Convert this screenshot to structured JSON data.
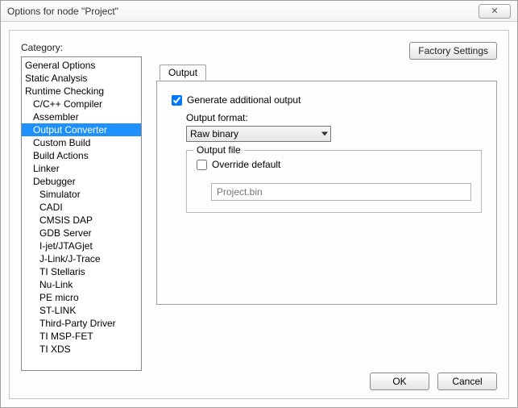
{
  "window": {
    "title": "Options for node \"Project\"",
    "close_label": "✕"
  },
  "category_label": "Category:",
  "categories": [
    {
      "label": "General Options",
      "indent": false
    },
    {
      "label": "Static Analysis",
      "indent": false
    },
    {
      "label": "Runtime Checking",
      "indent": false
    },
    {
      "label": "C/C++ Compiler",
      "indent": true
    },
    {
      "label": "Assembler",
      "indent": true
    },
    {
      "label": "Output Converter",
      "indent": true,
      "selected": true
    },
    {
      "label": "Custom Build",
      "indent": true
    },
    {
      "label": "Build Actions",
      "indent": true
    },
    {
      "label": "Linker",
      "indent": true
    },
    {
      "label": "Debugger",
      "indent": true
    },
    {
      "label": "Simulator",
      "indent": true,
      "deep": true
    },
    {
      "label": "CADI",
      "indent": true,
      "deep": true
    },
    {
      "label": "CMSIS DAP",
      "indent": true,
      "deep": true
    },
    {
      "label": "GDB Server",
      "indent": true,
      "deep": true
    },
    {
      "label": "I-jet/JTAGjet",
      "indent": true,
      "deep": true
    },
    {
      "label": "J-Link/J-Trace",
      "indent": true,
      "deep": true
    },
    {
      "label": "TI Stellaris",
      "indent": true,
      "deep": true
    },
    {
      "label": "Nu-Link",
      "indent": true,
      "deep": true
    },
    {
      "label": "PE micro",
      "indent": true,
      "deep": true
    },
    {
      "label": "ST-LINK",
      "indent": true,
      "deep": true
    },
    {
      "label": "Third-Party Driver",
      "indent": true,
      "deep": true
    },
    {
      "label": "TI MSP-FET",
      "indent": true,
      "deep": true
    },
    {
      "label": "TI XDS",
      "indent": true,
      "deep": true
    }
  ],
  "factory_btn": "Factory Settings",
  "tab": {
    "output": "Output"
  },
  "form": {
    "generate_label": "Generate additional output",
    "generate_checked": true,
    "format_label": "Output format:",
    "format_value": "Raw binary",
    "outfile_legend": "Output file",
    "override_label": "Override default",
    "override_checked": false,
    "filename_placeholder": "Project.bin"
  },
  "footer": {
    "ok": "OK",
    "cancel": "Cancel"
  }
}
